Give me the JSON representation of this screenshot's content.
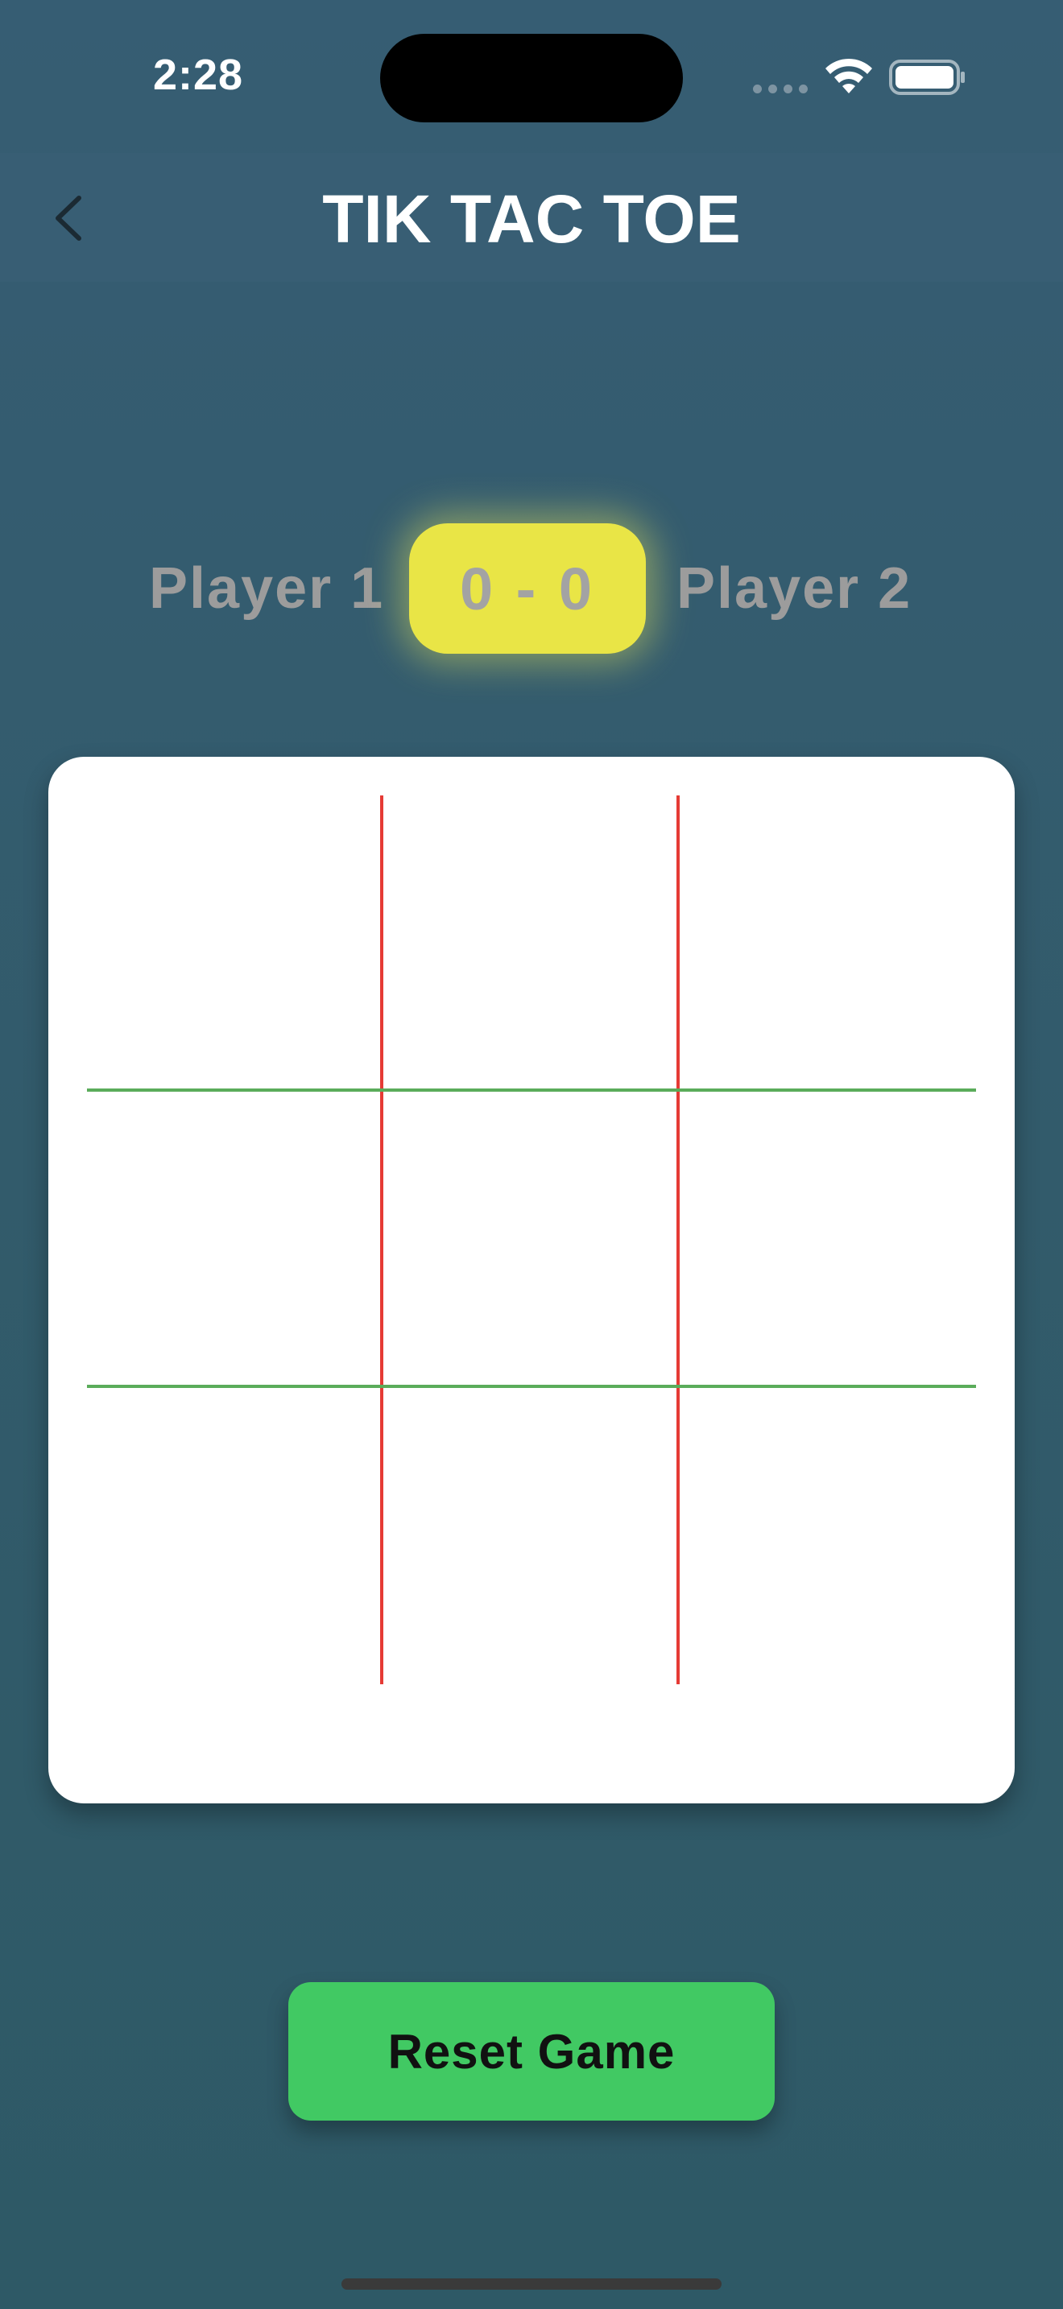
{
  "status_bar": {
    "time": "2:28"
  },
  "header": {
    "title": "TIK TAC TOE",
    "back_icon": "chevron-left-icon"
  },
  "scoreboard": {
    "player1_label": "Player 1",
    "player2_label": "Player 2",
    "score": "0 - 0",
    "pill_color": "#e9e546"
  },
  "board": {
    "cells": [
      "",
      "",
      "",
      "",
      "",
      "",
      "",
      "",
      ""
    ],
    "vertical_line_color": "#e53b35",
    "horizontal_line_color": "#5aac5a"
  },
  "actions": {
    "reset_label": "Reset Game",
    "reset_color": "#41c963"
  }
}
